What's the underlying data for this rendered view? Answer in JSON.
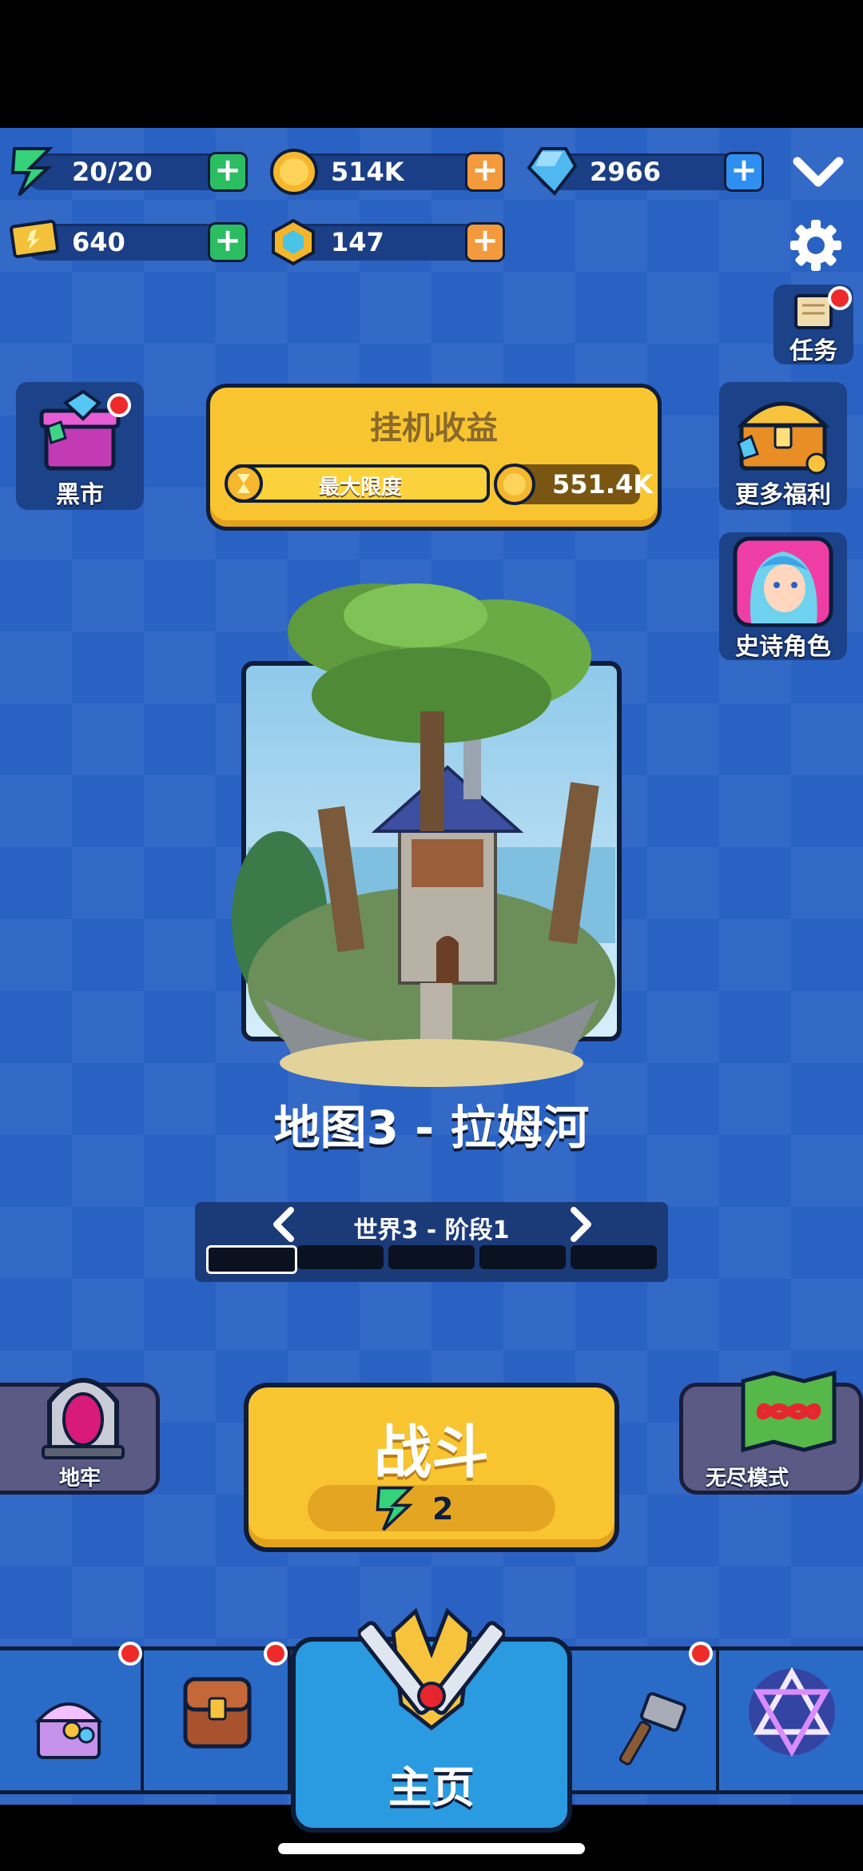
{
  "resources": {
    "energy": "20/20",
    "coins": "514K",
    "gems": "2966",
    "tickets": "640",
    "tokens": "147"
  },
  "side_left": {
    "black_market": "黑市"
  },
  "side_right": {
    "tasks": "任务",
    "more_benefits": "更多福利",
    "epic_hero": "史诗角色"
  },
  "idle_rewards": {
    "title": "挂机收益",
    "progress_label": "最大限度",
    "progress": 1.0,
    "amount": "551.4K"
  },
  "map": {
    "name": "地图3 - 拉姆河"
  },
  "stage": {
    "label": "世界3 - 阶段1",
    "segments_total": 5,
    "current_segment": 1
  },
  "modes": {
    "dungeon": "地牢",
    "endless": "无尽模式"
  },
  "fight": {
    "label": "战斗",
    "cost": "2"
  },
  "bottom_nav": {
    "home": "主页"
  },
  "colors": {
    "accent_yellow": "#f8c531",
    "background_blue": "#2a62c4",
    "plus_green": "#2cbd63",
    "plus_orange": "#f39a3c",
    "plus_blue": "#2f8ff0",
    "badge_red": "#ef2a2a"
  }
}
